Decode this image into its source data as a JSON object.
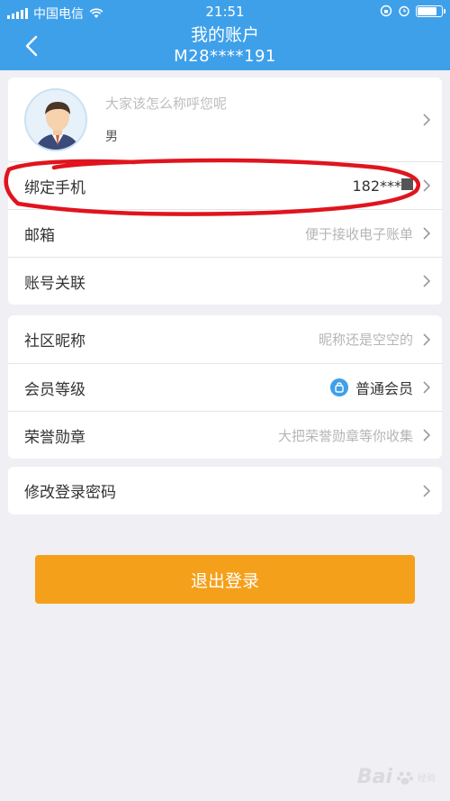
{
  "status_bar": {
    "carrier": "中国电信",
    "time": "21:51",
    "battery_level": 0.85
  },
  "header": {
    "title": "我的账户",
    "subtitle": "M28****191",
    "background_color": "#3fa0ea"
  },
  "profile": {
    "nickname_placeholder": "大家该怎么称呼您呢",
    "gender": "男"
  },
  "account_rows": [
    {
      "label": "绑定手机",
      "value": "182***"
    },
    {
      "label": "邮箱",
      "value": "便于接收电子账单"
    },
    {
      "label": "账号关联",
      "value": ""
    }
  ],
  "community_rows": [
    {
      "label": "社区昵称",
      "value": "昵称还是空空的"
    },
    {
      "label": "会员等级",
      "value": "普通会员"
    },
    {
      "label": "荣誉勋章",
      "value": "大把荣誉勋章等你收集"
    }
  ],
  "password_row": {
    "label": "修改登录密码"
  },
  "logout_button": {
    "label": "退出登录",
    "color": "#f5a01a"
  },
  "watermark": {
    "text": "Bai",
    "sub": "经验"
  },
  "annotation_color": "#e0141e"
}
